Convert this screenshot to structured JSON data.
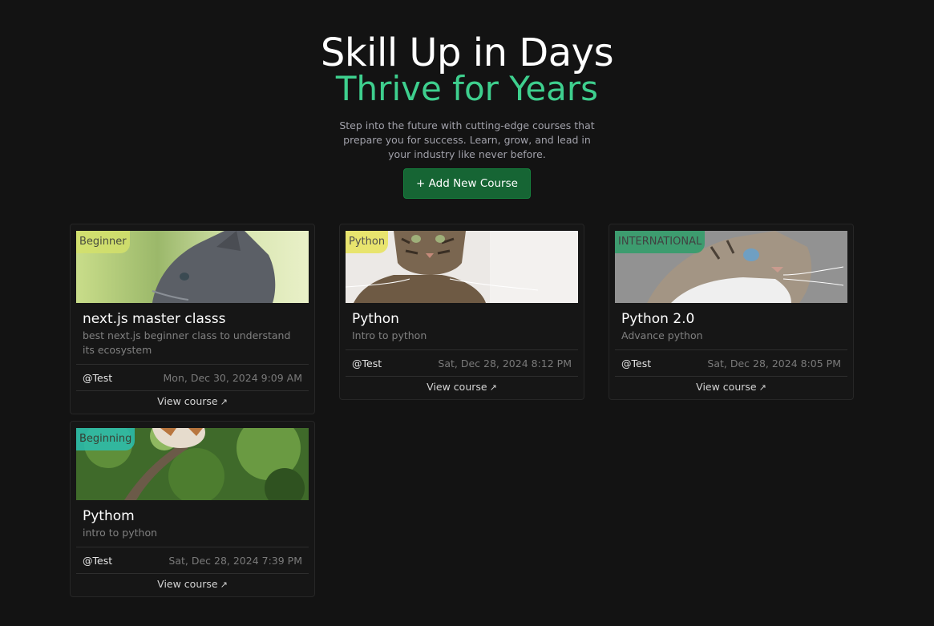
{
  "hero": {
    "title": "Skill Up in Days",
    "subtitle": "Thrive for Years",
    "lead": "Step into the future with cutting-edge courses that prepare you for success. Learn, grow, and lead in your industry like never before.",
    "add_button": "+ Add New Course"
  },
  "colors": {
    "accent": "#3ecf8e",
    "button_bg": "#166534",
    "background": "#131313"
  },
  "courses": [
    {
      "badge": "Beginner",
      "badge_color": "#d4e16b",
      "title": "next.js master classs",
      "description": "best next.js beginner class to understand its ecosystem",
      "author": "@Test",
      "date": "Mon, Dec 30, 2024 9:09 AM",
      "view_label": "View course",
      "arrow": "↗",
      "image": "gray-cat-profile"
    },
    {
      "badge": "Python",
      "badge_color": "#e8e45a",
      "title": "Python",
      "description": "Intro to python",
      "author": "@Test",
      "date": "Sat, Dec 28, 2024 8:12 PM",
      "view_label": "View course",
      "arrow": "↗",
      "image": "tabby-cat-lying"
    },
    {
      "badge": "INTERNATIONAL",
      "badge_color": "#2f9e6a",
      "title": "Python 2.0",
      "description": "Advance python",
      "author": "@Test",
      "date": "Sat, Dec 28, 2024 8:05 PM",
      "view_label": "View course",
      "arrow": "↗",
      "image": "tabby-cat-closeup"
    },
    {
      "badge": "Beginning",
      "badge_color": "#2bbfb0",
      "title": "Pythom",
      "description": "intro to python",
      "author": "@Test",
      "date": "Sat, Dec 28, 2024 7:39 PM",
      "view_label": "View course",
      "arrow": "↗",
      "image": "kitten-in-tree"
    }
  ]
}
